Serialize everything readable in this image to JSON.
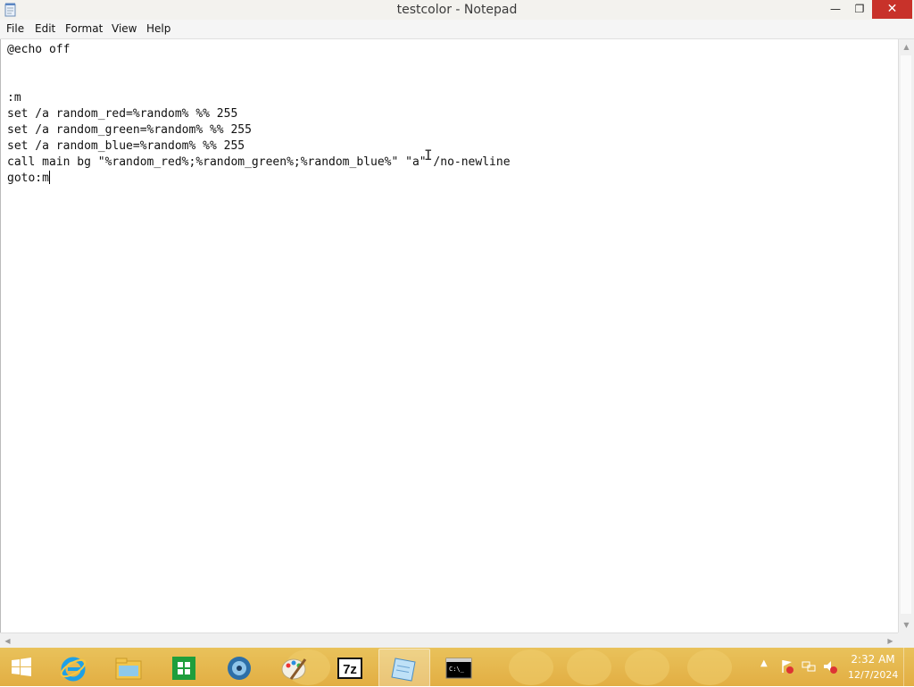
{
  "window": {
    "title": "testcolor - Notepad",
    "minimize_label": "—",
    "maximize_label": "❐",
    "close_label": "✕"
  },
  "menu": {
    "file": "File",
    "edit": "Edit",
    "format": "Format",
    "view": "View",
    "help": "Help"
  },
  "editor": {
    "lines": [
      "@echo off",
      "",
      "",
      ":m",
      "set /a random_red=%random% %% 255",
      "set /a random_green=%random% %% 255",
      "set /a random_blue=%random% %% 255",
      "call main bg \"%random_red%;%random_green%;%random_blue%\" \"a\" /no-newline",
      "goto:m"
    ]
  },
  "taskbar": {
    "apps": [
      {
        "name": "start-icon"
      },
      {
        "name": "internet-explorer-icon"
      },
      {
        "name": "file-explorer-icon"
      },
      {
        "name": "store-icon"
      },
      {
        "name": "media-player-icon"
      },
      {
        "name": "paint-icon"
      },
      {
        "name": "7zip-icon"
      },
      {
        "name": "notepad-icon",
        "active": true
      },
      {
        "name": "command-prompt-icon"
      }
    ],
    "tray_icons": [
      "show-hidden-icons-arrow",
      "action-center-flag-icon",
      "network-icon",
      "volume-muted-icon"
    ],
    "clock": {
      "time": "2:32 AM",
      "date": "12/7/2024"
    }
  },
  "colors": {
    "close_button": "#c8322a",
    "taskbar": "#e2ae43",
    "titlebar": "#f3f2ee"
  }
}
